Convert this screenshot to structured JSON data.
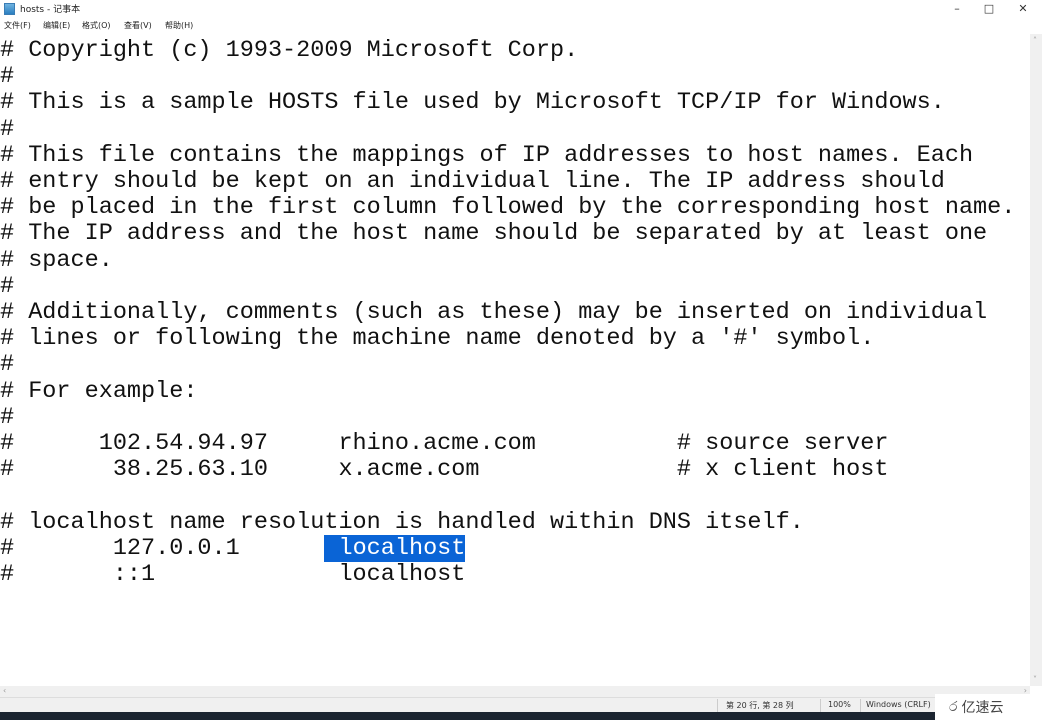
{
  "window": {
    "title": "hosts - 记事本",
    "minimize": "–",
    "maximize": "□",
    "close": "✕"
  },
  "menu": [
    "文件(F)",
    "编辑(E)",
    "格式(O)",
    "查看(V)",
    "帮助(H)"
  ],
  "editor": {
    "lines": [
      "# Copyright (c) 1993-2009 Microsoft Corp.",
      "#",
      "# This is a sample HOSTS file used by Microsoft TCP/IP for Windows.",
      "#",
      "# This file contains the mappings of IP addresses to host names. Each",
      "# entry should be kept on an individual line. The IP address should",
      "# be placed in the first column followed by the corresponding host name.",
      "# The IP address and the host name should be separated by at least one",
      "# space.",
      "#",
      "# Additionally, comments (such as these) may be inserted on individual",
      "# lines or following the machine name denoted by a '#' symbol.",
      "#",
      "# For example:",
      "#",
      "#      102.54.94.97     rhino.acme.com          # source server",
      "#       38.25.63.10     x.acme.com              # x client host",
      "",
      "# localhost name resolution is handled within DNS itself.",
      {
        "before": "#       127.0.0.1      ",
        "selected": " localhost",
        "after": ""
      },
      "#       ::1             localhost"
    ]
  },
  "statusbar": {
    "position": "第 20 行, 第 28 列",
    "zoom": "100%",
    "encoding": "Windows (CRLF)"
  },
  "watermark": {
    "logo": "ර",
    "text": "亿速云"
  }
}
